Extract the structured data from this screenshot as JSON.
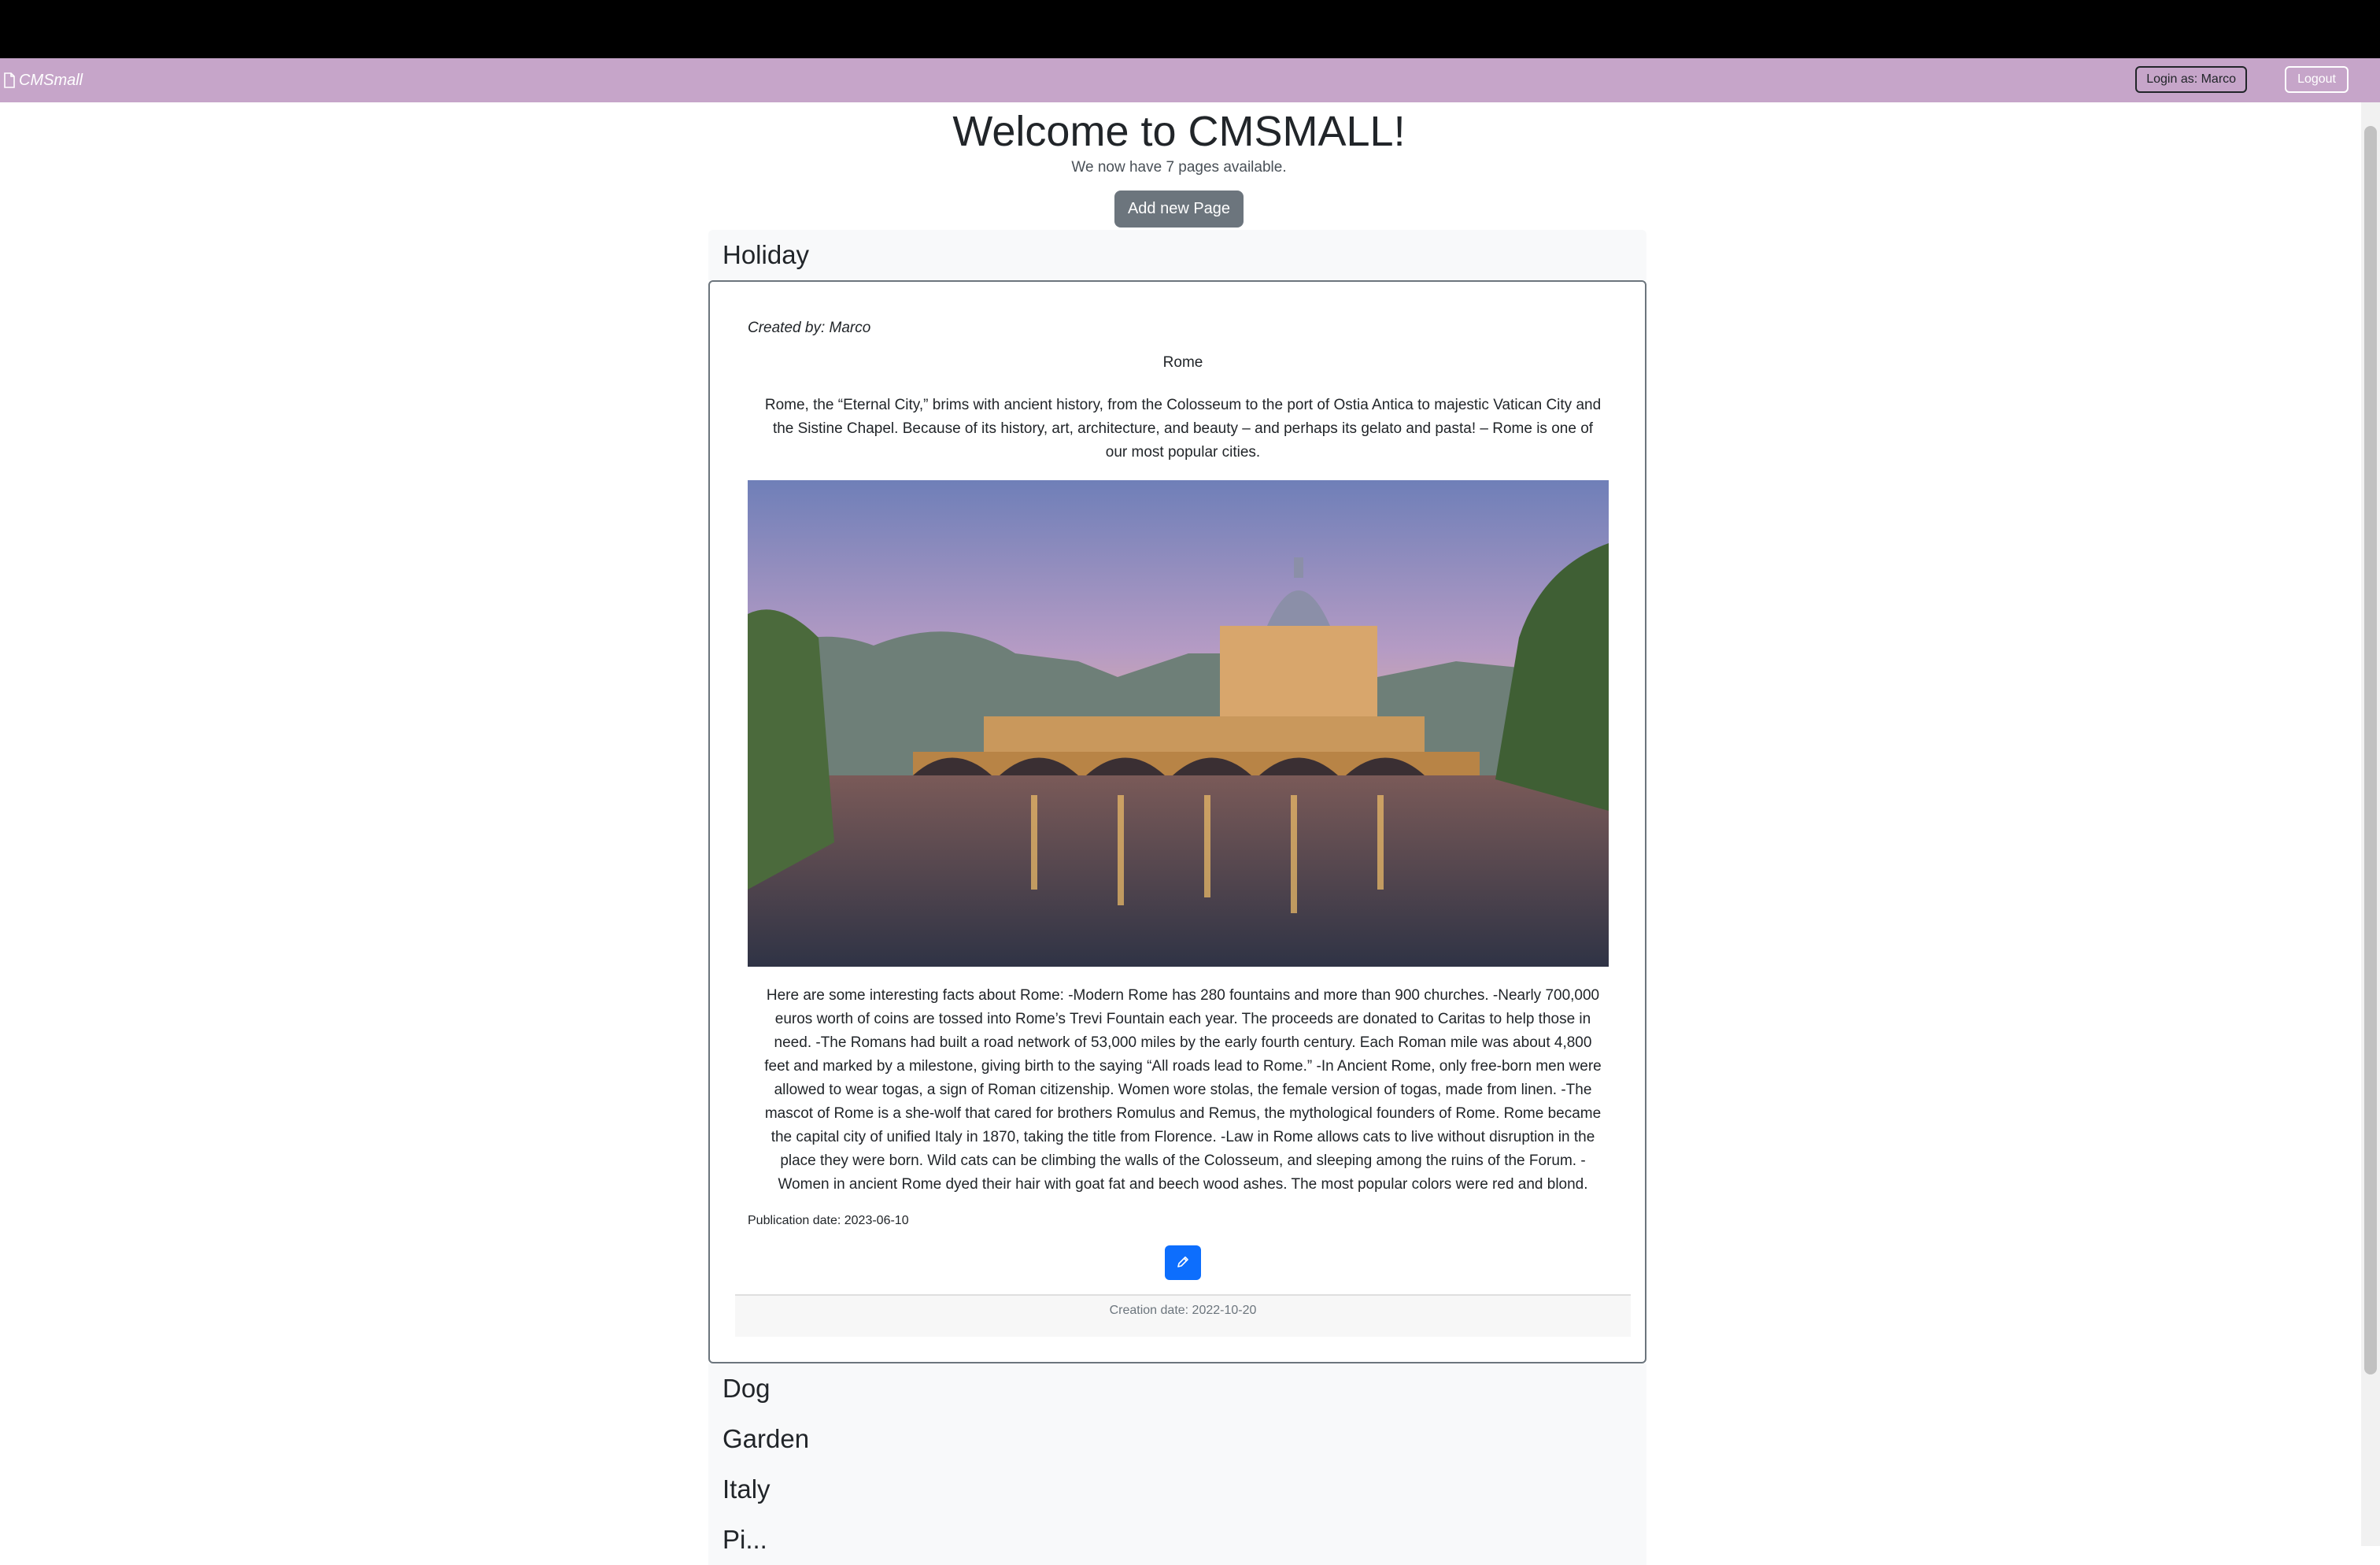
{
  "navbar": {
    "brand": "CMSmall",
    "login_label": "Login as: Marco",
    "logout_label": "Logout"
  },
  "main": {
    "title": "Welcome to CMSMALL!",
    "subtitle": "We now have 7 pages available.",
    "add_button": "Add new Page"
  },
  "pages": {
    "open": {
      "title": "Holiday",
      "created_by": "Created by: Marco",
      "header_block": "Rome",
      "paragraph_1": "Rome, the “Eternal City,” brims with ancient history, from the Colosseum to the port of Ostia Antica to majestic Vatican City and the Sistine Chapel. Because of its history, art, architecture, and beauty – and perhaps its gelato and pasta! – Rome is one of our most popular cities.",
      "paragraph_2": "Here are some interesting facts about Rome: -Modern Rome has 280 fountains and more than 900 churches. -Nearly 700,000 euros worth of coins are tossed into Rome’s Trevi Fountain each year. The proceeds are donated to Caritas to help those in need. -The Romans had built a road network of 53,000 miles by the early fourth century. Each Roman mile was about 4,800 feet and marked by a milestone, giving birth to the saying “All roads lead to Rome.” -In Ancient Rome, only free-born men were allowed to wear togas, a sign of Roman citizenship. Women wore stolas, the female version of togas, made from linen. -The mascot of Rome is a she-wolf that cared for brothers Romulus and Remus, the mythological founders of Rome. Rome became the capital city of unified Italy in 1870, taking the title from Florence. -Law in Rome allows cats to live without disruption in the place they were born. Wild cats can be climbing the walls of the Colosseum, and sleeping among the ruins of the Forum. -Women in ancient Rome dyed their hair with goat fat and beech wood ashes. The most popular colors were red and blond.",
      "publication_date": "Publication date: 2023-06-10",
      "creation_date": "Creation date: 2022-10-20"
    },
    "collapsed": [
      "Dog",
      "Garden",
      "Italy",
      "Pi..."
    ]
  },
  "icons": {
    "brand": "document-icon",
    "edit": "pencil-icon"
  },
  "colors": {
    "navbar": "#c6a5c9",
    "add_button": "#6c757d",
    "edit_button": "#0d6efd"
  }
}
